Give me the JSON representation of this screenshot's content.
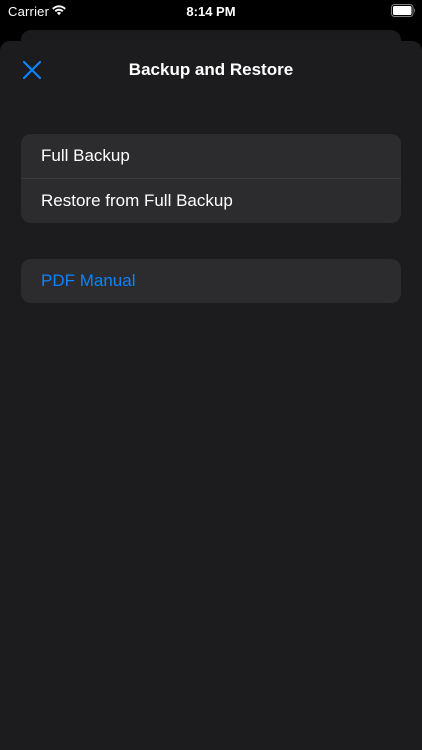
{
  "status_bar": {
    "carrier": "Carrier",
    "time": "8:14 PM",
    "wifi_icon": "wifi-icon",
    "battery_icon": "battery-icon"
  },
  "nav": {
    "title": "Backup and Restore",
    "close_icon": "close-icon"
  },
  "backup_group": {
    "items": [
      {
        "label": "Full Backup"
      },
      {
        "label": "Restore from Full Backup"
      }
    ]
  },
  "manual_group": {
    "items": [
      {
        "label": "PDF Manual"
      }
    ]
  },
  "colors": {
    "background": "#000000",
    "sheet": "#1c1c1e",
    "cell": "#2c2c2e",
    "separator": "#3a3a3c",
    "text": "#ffffff",
    "accent": "#0a84ff"
  }
}
